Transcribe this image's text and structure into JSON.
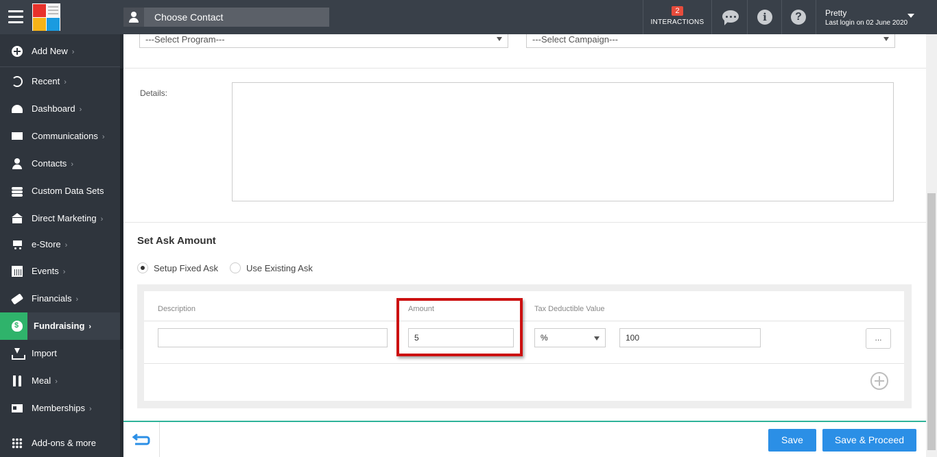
{
  "topbar": {
    "contact_label": "Choose Contact",
    "interactions_count": "2",
    "interactions_label": "INTERACTIONS",
    "user_name": "Pretty",
    "last_login": "Last login on 02 June 2020",
    "icons": [
      "menu-icon",
      "chat-icon",
      "info-icon",
      "help-icon"
    ]
  },
  "sidebar": {
    "items": [
      {
        "label": "Add New",
        "icon": "plus-circle-icon",
        "chevron": "›"
      },
      {
        "label": "Recent",
        "icon": "history-icon",
        "chevron": "›"
      },
      {
        "label": "Dashboard",
        "icon": "gauge-icon",
        "chevron": "›"
      },
      {
        "label": "Communications",
        "icon": "envelope-icon",
        "chevron": "›"
      },
      {
        "label": "Contacts",
        "icon": "person-icon",
        "chevron": "›"
      },
      {
        "label": "Custom Data Sets",
        "icon": "layers-icon",
        "chevron": ""
      },
      {
        "label": "Direct Marketing",
        "icon": "bank-icon",
        "chevron": "›"
      },
      {
        "label": "e-Store",
        "icon": "cart-icon",
        "chevron": "›"
      },
      {
        "label": "Events",
        "icon": "calendar-icon",
        "chevron": "›"
      },
      {
        "label": "Financials",
        "icon": "ticket-icon",
        "chevron": "›"
      },
      {
        "label": "Fundraising",
        "icon": "money-bag-icon",
        "chevron": "›"
      },
      {
        "label": "Import",
        "icon": "import-icon",
        "chevron": ""
      },
      {
        "label": "Meal",
        "icon": "meal-icon",
        "chevron": "›"
      },
      {
        "label": "Memberships",
        "icon": "id-card-icon",
        "chevron": "›"
      },
      {
        "label": "Add-ons & more",
        "icon": "grid-icon",
        "chevron": ""
      }
    ]
  },
  "form": {
    "program_select": "---Select Program---",
    "campaign_select": "---Select Campaign---",
    "details_label": "Details:",
    "details_value": "",
    "section_title": "Set Ask Amount",
    "radio_fixed": "Setup Fixed Ask",
    "radio_existing": "Use Existing Ask",
    "selected_radio": "Setup Fixed Ask"
  },
  "ask_table": {
    "headers": {
      "description": "Description",
      "amount": "Amount",
      "tax": "Tax Deductible Value"
    },
    "row": {
      "description": "",
      "amount": "5",
      "tax_unit": "%",
      "tax_value": "100",
      "more_label": "..."
    }
  },
  "footer": {
    "save_label": "Save",
    "save_proceed_label": "Save & Proceed"
  },
  "colors": {
    "topbar": "#394049",
    "sidebar": "#2f353d",
    "active_accent": "#2fb36b",
    "primary_button": "#2b8fe6",
    "highlight": "#cc1111"
  }
}
